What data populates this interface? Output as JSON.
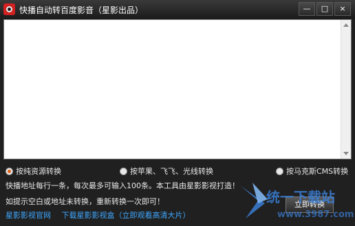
{
  "window": {
    "title": "快播自动转百度影音（星影出品）",
    "minimize_label": "—",
    "maximize_label": "□",
    "close_label": "×"
  },
  "options": [
    {
      "label": "按纯资源转换",
      "checked": true
    },
    {
      "label": "按苹果、飞飞、光线转换",
      "checked": false
    },
    {
      "label": "按马克斯CMS转换",
      "checked": false
    }
  ],
  "info": {
    "line1": "快播地址每行一条，每次最多可输入100条。本工具由星影影视打造！",
    "line2": "如提示空白或地址未转换，重新转换一次即可！"
  },
  "links": {
    "site": "星影影视官网",
    "download": "下载星影影视盒（立即观看高清大片）"
  },
  "buttons": {
    "convert": "立即转换"
  },
  "watermark": {
    "text": "统一下载站",
    "url": "www.3987.com"
  },
  "colors": {
    "link": "#3fa8ff",
    "radio_selected": "#e06010",
    "app_icon": "#d32020"
  }
}
